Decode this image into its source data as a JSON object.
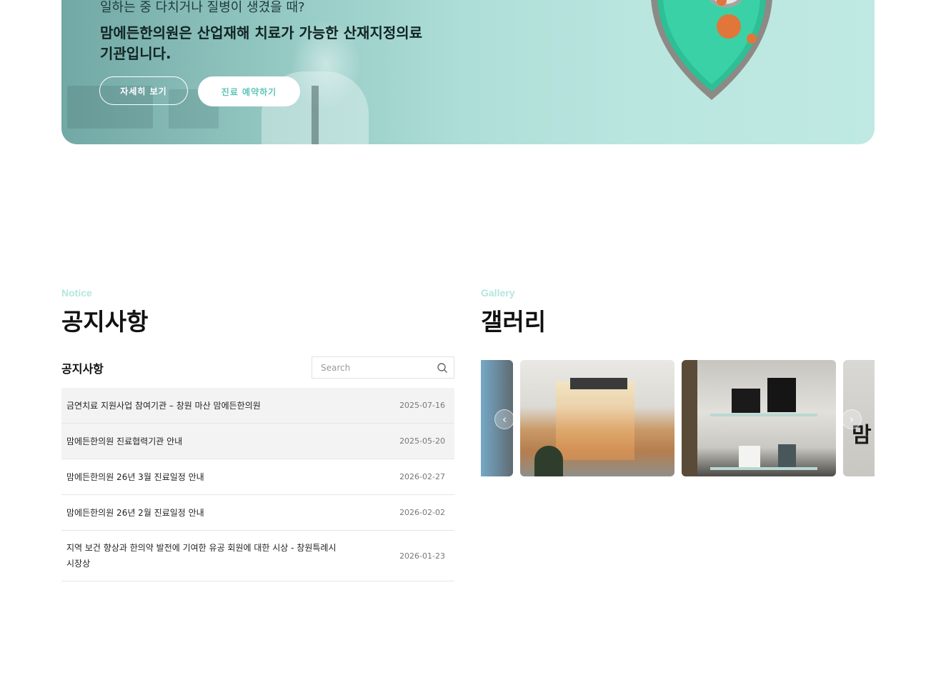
{
  "hero": {
    "line1": "일하는 중 다치거나 질병이 생겼을 때?",
    "line2": "맘에든한의원은 산업재해 치료가 가능한 산재지정의료기관입니다.",
    "btn_detail": "자세히 보기",
    "btn_reserve": "진료 예약하기"
  },
  "notice": {
    "en": "Notice",
    "title": "공지사항",
    "subtitle": "공지사항",
    "search_placeholder": "Search",
    "items": [
      {
        "title": "금연치료 지원사업 참여기관 – 창원 마산 맘에든한의원",
        "date": "2025-07-16"
      },
      {
        "title": "맘에든한의원 진료협력기관 안내",
        "date": "2025-05-20"
      },
      {
        "title": "맘에든한의원 26년 3월 진료일정 안내",
        "date": "2026-02-27"
      },
      {
        "title": "맘에든한의원 26년 2월 진료일정 안내",
        "date": "2026-02-02"
      },
      {
        "title": "지역 보건 향상과 한의약 발전에 기여한 유공 회원에 대한 시상 - 창원특례시 시장상",
        "date": "2026-01-23"
      }
    ]
  },
  "gallery": {
    "en": "Gallery",
    "title": "갤러리",
    "prev_icon": "chevron-left-icon",
    "next_icon": "chevron-right-icon"
  },
  "colors": {
    "accent": "#5cc5b7",
    "accent_light": "#b3e6df"
  }
}
